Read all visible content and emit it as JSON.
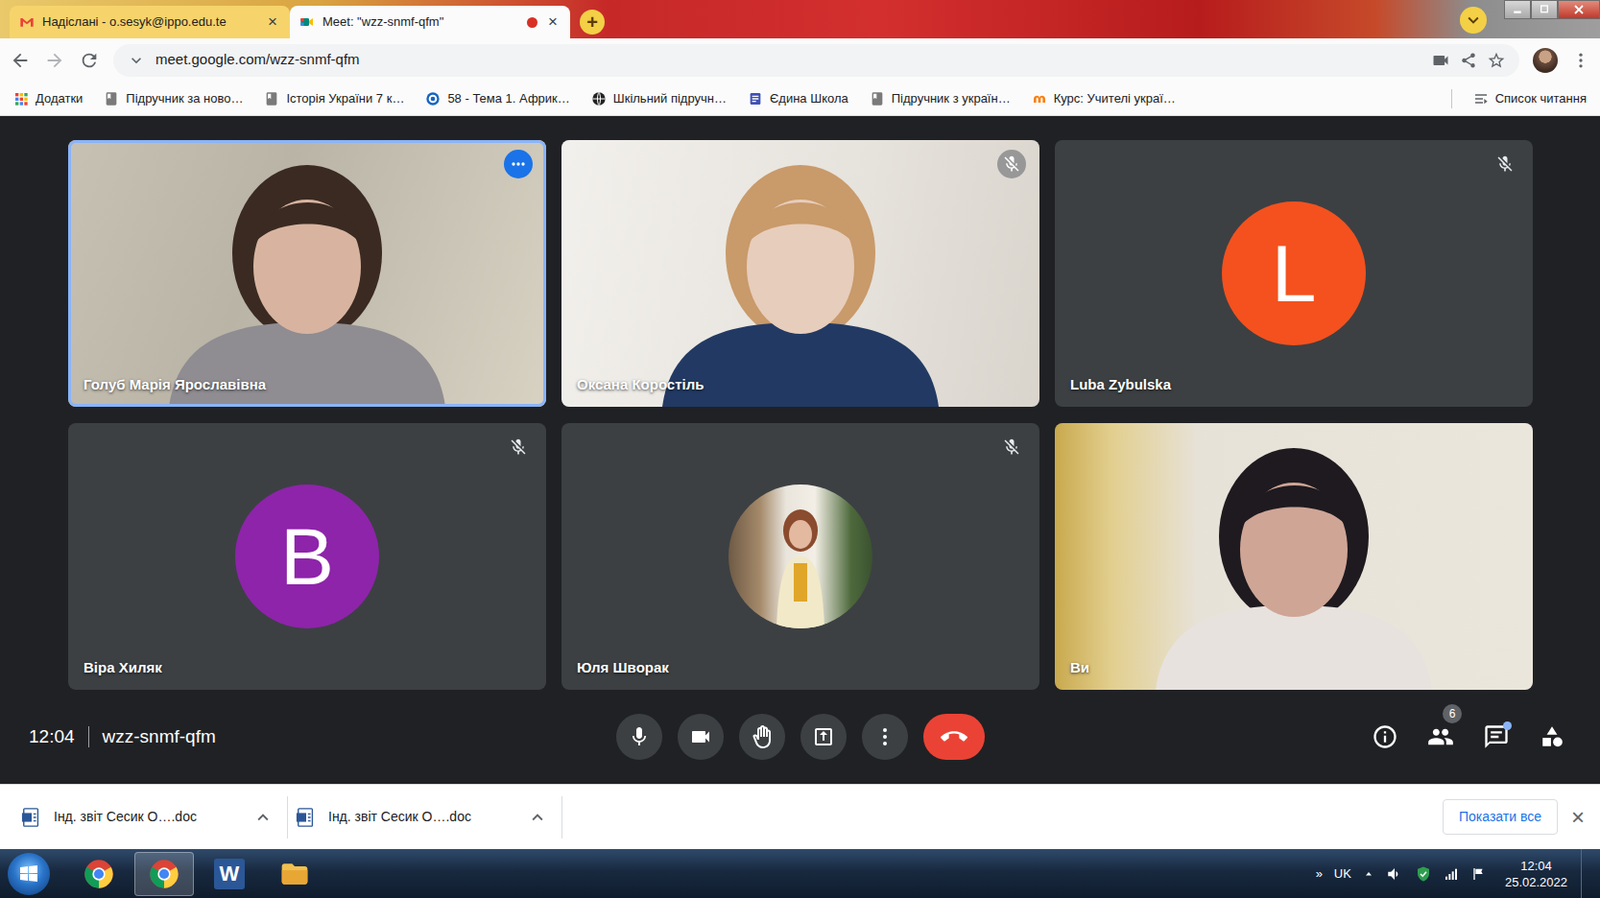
{
  "browser": {
    "tabs": [
      {
        "label": "Надіслані - o.sesyk@ippo.edu.te",
        "kind": "gmail",
        "selected": false,
        "recording": false,
        "close": "×"
      },
      {
        "label": "Meet: \"wzz-snmf-qfm\"",
        "kind": "meet",
        "selected": true,
        "recording": true,
        "close": "×"
      }
    ],
    "new_tab": "+",
    "address": "meet.google.com/wzz-snmf-qfm",
    "bookmarks": [
      {
        "label": "Додатки",
        "kind": "apps"
      },
      {
        "label": "Підручник за ново…",
        "kind": "book"
      },
      {
        "label": "Історія України 7 к…",
        "kind": "book"
      },
      {
        "label": "58 - Тема 1. Африк…",
        "kind": "g"
      },
      {
        "label": "Шкільний підручн…",
        "kind": "globe"
      },
      {
        "label": "Єдина Школа",
        "kind": "doc"
      },
      {
        "label": "Підручник з україн…",
        "kind": "book"
      },
      {
        "label": "Курс: Учителі украї…",
        "kind": "moodle"
      }
    ],
    "reading_list": "Список читання"
  },
  "meet": {
    "participants": [
      {
        "name": "Голуб Марія Ярославівна",
        "kind": "video",
        "muted": false,
        "speaking": true,
        "options_shown": true
      },
      {
        "name": "Оксана Коростіль",
        "kind": "video",
        "muted": true,
        "speaking": false,
        "options_shown": false
      },
      {
        "name": "Luba Zybulska",
        "kind": "avatar",
        "initial": "L",
        "color": "#f4511e",
        "muted": true,
        "speaking": false,
        "options_shown": false
      },
      {
        "name": "Віра Хиляк",
        "kind": "avatar",
        "initial": "В",
        "color": "#8e24aa",
        "muted": true,
        "speaking": false,
        "options_shown": false
      },
      {
        "name": "Юля Шворак",
        "kind": "photo",
        "muted": true,
        "speaking": false,
        "options_shown": false
      },
      {
        "name": "Ви",
        "kind": "video",
        "muted": false,
        "speaking": false,
        "options_shown": false
      }
    ],
    "time": "12:04",
    "code": "wzz-snmf-qfm",
    "people_count": "6",
    "chat_unread": true
  },
  "downloads": {
    "items": [
      {
        "label": "Інд. звіт Сесик О….doc"
      },
      {
        "label": "Інд. звіт Сесик О….doc"
      }
    ],
    "show_all": "Показати все",
    "close": "×"
  },
  "taskbar": {
    "apps": [
      {
        "kind": "chrome",
        "selected": false
      },
      {
        "kind": "chrome",
        "selected": true
      },
      {
        "kind": "word",
        "selected": false,
        "logo": "W"
      },
      {
        "kind": "explorer",
        "selected": false
      }
    ],
    "tray_more": "»",
    "language": "UK",
    "time": "12:04",
    "date": "25.02.2022"
  }
}
